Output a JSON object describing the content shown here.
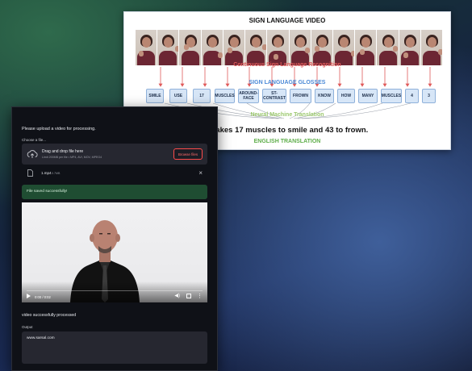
{
  "diagram": {
    "title": "SIGN LANGUAGE VIDEO",
    "recognition_label": "Continuous Sign Language Recognition",
    "glosses_title": "SIGN LANGUAGE GLOSSES",
    "glosses": [
      "SMILE",
      "USE",
      "17",
      "MUSCLES",
      "AROUND-FACE",
      "ST-CONTRAST",
      "FROWN",
      "KNOW",
      "HOW",
      "MANY",
      "MUSCLES",
      "4",
      "3"
    ],
    "translation_label": "Neural Machine Translation",
    "sentence": "It takes 17 muscles to smile and 43 to frown.",
    "english_label": "ENGLISH TRANSLATION",
    "colors": {
      "recognition": "#e05a5a",
      "glosses": "#4a88d6",
      "translation": "#9cc96e",
      "english": "#5fae4a"
    }
  },
  "app": {
    "prompt": "Please upload a video for processing.",
    "uploader": {
      "label": "Choose a file...",
      "drop_title": "Drag and drop file here",
      "drop_hint": "Limit 200MB per file • MP4, AVI, MOV, MPEG4",
      "browse_label": "Browse files",
      "file_name": "1.mp4",
      "file_size": "0.7MB",
      "remove_icon": "close-icon"
    },
    "success_message": "File saved successfully!",
    "video": {
      "time": "0:00 / 0:02",
      "progress": 0
    },
    "processed_message": "video successfully processed",
    "output": {
      "label": "Output",
      "value": "www.sarsal.com"
    },
    "colors": {
      "background": "#0f1117",
      "success_bg": "#1f4d32",
      "accent": "#ff4b4b",
      "input_bg": "#262730"
    }
  }
}
